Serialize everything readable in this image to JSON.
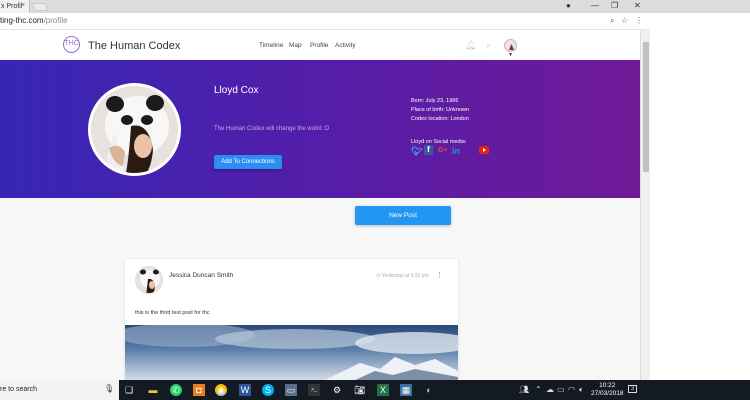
{
  "browser": {
    "tab_title": "x Profil",
    "tab_close": "×",
    "url_host": "ting-thc.com",
    "url_path": "/profile",
    "window_controls": [
      "minimize-icon",
      "restore-icon",
      "close-icon"
    ]
  },
  "nav": {
    "brand": "The Human Codex",
    "logo_text": "THC",
    "links": [
      "Timeline",
      "Map",
      "Profile",
      "Activity"
    ],
    "icons": [
      "bell-icon",
      "search-icon",
      "user-avatar"
    ]
  },
  "profile": {
    "name": "Lloyd Cox",
    "tagline": "The Human Codex will change the world :D",
    "connect_button": "Add To Connections",
    "born": "Born: July 23, 1986",
    "place_of_birth": "Place of birth: Unknown",
    "codex_location": "Codex location: London",
    "social_label": "Lloyd on Social media:",
    "social_icons": [
      "twitter-icon",
      "facebook-icon",
      "google-plus-icon",
      "linkedin-icon",
      "youtube-icon"
    ]
  },
  "actions": {
    "new_post": "New Post"
  },
  "post": {
    "author": "Jessica Duncan Smith",
    "time": "Yesterday at 6:32 pm",
    "text": "this is the third test post for thc"
  },
  "taskbar": {
    "search_text": "re to search",
    "time": "10:22",
    "date": "27/03/2018",
    "notification_count": "3"
  },
  "colors": {
    "hero_start": "#3626b5",
    "hero_end": "#6f1a96",
    "accent_button": "#2296f3"
  }
}
